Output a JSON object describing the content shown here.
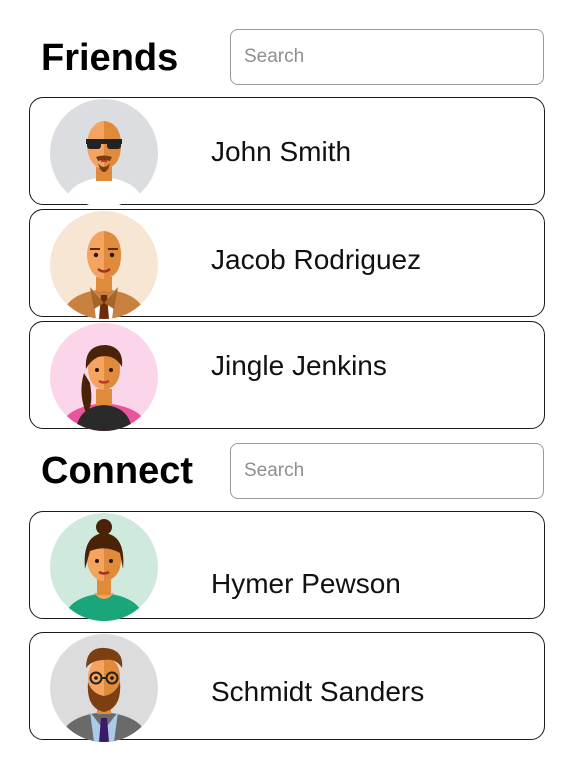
{
  "friends": {
    "title": "Friends",
    "search_placeholder": "Search",
    "people": [
      {
        "name": "John Smith",
        "avatar_icon": "bald-man-sunglasses-avatar",
        "avatar_bg": "#dcdde0"
      },
      {
        "name": "Jacob Rodriguez",
        "avatar_icon": "bald-man-suit-avatar",
        "avatar_bg": "#f7e6d3"
      },
      {
        "name": "Jingle Jenkins",
        "avatar_icon": "woman-ponytail-avatar",
        "avatar_bg": "#fbd6ea"
      }
    ]
  },
  "connect": {
    "title": "Connect",
    "search_placeholder": "Search",
    "people": [
      {
        "name": "Hymer Pewson",
        "avatar_icon": "woman-bun-avatar",
        "avatar_bg": "#cfe9dd"
      },
      {
        "name": "Schmidt Sanders",
        "avatar_icon": "bearded-man-glasses-avatar",
        "avatar_bg": "#dcdcdc"
      }
    ]
  },
  "colors": {
    "skin": "#f4a460",
    "skin_shade": "#e08a3c",
    "card_border": "#1a1a1a"
  }
}
